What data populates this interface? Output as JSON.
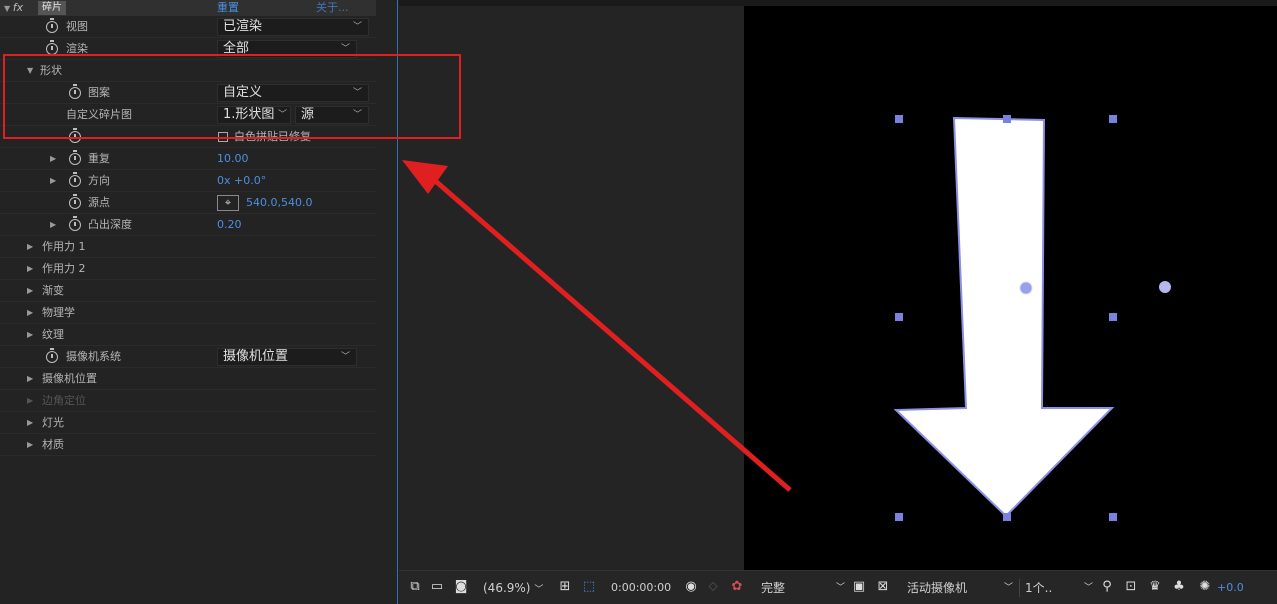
{
  "effect_panel": {
    "fx_icon": "fx",
    "effect_name": "碎片",
    "reset_label": "重置",
    "about_label": "关于...",
    "rows": {
      "view": {
        "label": "视图",
        "value": "已渲染"
      },
      "render": {
        "label": "渲染",
        "value": "全部"
      },
      "shape": {
        "label": "形状"
      },
      "pattern": {
        "label": "图案",
        "value": "自定义"
      },
      "custom_shard_map": {
        "label": "自定义碎片图",
        "layer": "1.形状图",
        "source": "源"
      },
      "white_tiles": {
        "label": "白色拼贴已修复"
      },
      "repetitions": {
        "label": "重复",
        "value": "10.00"
      },
      "direction": {
        "label": "方向",
        "value": "0x +0.0°"
      },
      "origin": {
        "label": "源点",
        "value": "540.0,540.0"
      },
      "extrusion_depth": {
        "label": "凸出深度",
        "value": "0.20"
      },
      "force1": {
        "label": "作用力 1"
      },
      "force2": {
        "label": "作用力 2"
      },
      "gradient": {
        "label": "渐变"
      },
      "physics": {
        "label": "物理学"
      },
      "textures": {
        "label": "纹理"
      },
      "camera_system": {
        "label": "摄像机系统",
        "value": "摄像机位置"
      },
      "camera_position": {
        "label": "摄像机位置"
      },
      "corner_pins": {
        "label": "边角定位"
      },
      "lighting": {
        "label": "灯光"
      },
      "material": {
        "label": "材质"
      }
    }
  },
  "toolbar": {
    "zoom": "(46.9%)",
    "timecode": "0:00:00:00",
    "resolution": "完整",
    "camera": "活动摄像机",
    "views": "1个..",
    "exposure": "+0.0"
  },
  "colors": {
    "accent_blue": "#4d8fe0",
    "highlight_red": "#e02020",
    "handle": "#7a82e0"
  }
}
